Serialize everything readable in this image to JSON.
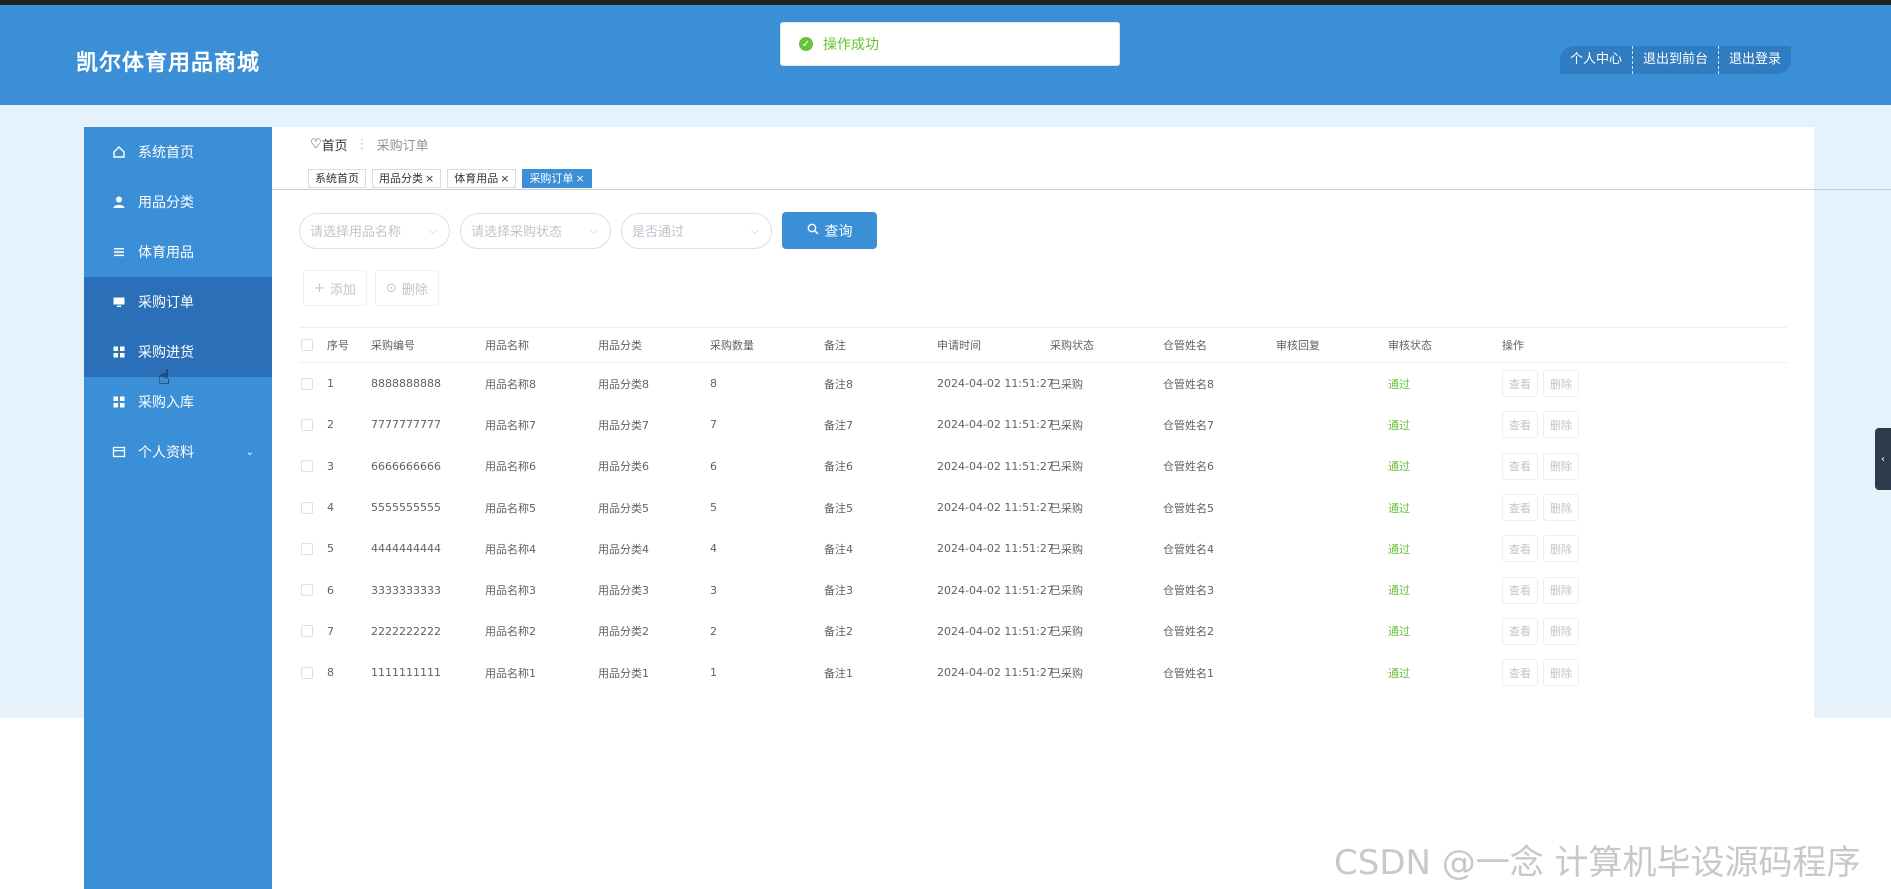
{
  "header": {
    "brand": "凯尔体育用品商城",
    "nav": [
      "个人中心",
      "退出到前台",
      "退出登录"
    ]
  },
  "toast": {
    "icon": "check-circle-icon",
    "text": "操作成功"
  },
  "sidebar": {
    "items": [
      {
        "label": "系统首页",
        "icon": "home-icon"
      },
      {
        "label": "用品分类",
        "icon": "user-icon"
      },
      {
        "label": "体育用品",
        "icon": "list-icon"
      },
      {
        "label": "采购订单",
        "icon": "monitor-icon"
      },
      {
        "label": "采购进货",
        "icon": "grid-icon"
      },
      {
        "label": "采购入库",
        "icon": "grid-icon"
      },
      {
        "label": "个人资料",
        "icon": "card-icon"
      }
    ]
  },
  "breadcrumb": {
    "home": "首页",
    "current": "采购订单"
  },
  "tags": [
    "系统首页",
    "用品分类",
    "体育用品",
    "采购订单"
  ],
  "filters": {
    "name_placeholder": "请选择用品名称",
    "status_placeholder": "请选择采购状态",
    "pass_placeholder": "是否通过",
    "query_label": "查询"
  },
  "actions": {
    "add": "添加",
    "delete": "删除"
  },
  "table": {
    "headers": [
      "序号",
      "采购编号",
      "用品名称",
      "用品分类",
      "采购数量",
      "备注",
      "申请时间",
      "采购状态",
      "仓管姓名",
      "审核回复",
      "审核状态",
      "操作"
    ],
    "rows": [
      [
        "1",
        "8888888888",
        "用品名称8",
        "用品分类8",
        "8",
        "备注8",
        "2024-04-02 11:51:27",
        "已采购",
        "仓管姓名8",
        "",
        "通过"
      ],
      [
        "2",
        "7777777777",
        "用品名称7",
        "用品分类7",
        "7",
        "备注7",
        "2024-04-02 11:51:27",
        "已采购",
        "仓管姓名7",
        "",
        "通过"
      ],
      [
        "3",
        "6666666666",
        "用品名称6",
        "用品分类6",
        "6",
        "备注6",
        "2024-04-02 11:51:27",
        "已采购",
        "仓管姓名6",
        "",
        "通过"
      ],
      [
        "4",
        "5555555555",
        "用品名称5",
        "用品分类5",
        "5",
        "备注5",
        "2024-04-02 11:51:27",
        "已采购",
        "仓管姓名5",
        "",
        "通过"
      ],
      [
        "5",
        "4444444444",
        "用品名称4",
        "用品分类4",
        "4",
        "备注4",
        "2024-04-02 11:51:27",
        "已采购",
        "仓管姓名4",
        "",
        "通过"
      ],
      [
        "6",
        "3333333333",
        "用品名称3",
        "用品分类3",
        "3",
        "备注3",
        "2024-04-02 11:51:27",
        "已采购",
        "仓管姓名3",
        "",
        "通过"
      ],
      [
        "7",
        "2222222222",
        "用品名称2",
        "用品分类2",
        "2",
        "备注2",
        "2024-04-02 11:51:27",
        "已采购",
        "仓管姓名2",
        "",
        "通过"
      ],
      [
        "8",
        "1111111111",
        "用品名称1",
        "用品分类1",
        "1",
        "备注1",
        "2024-04-02 11:51:27",
        "已采购",
        "仓管姓名1",
        "",
        "通过"
      ]
    ],
    "view_label": "查看",
    "delete_label": "删除"
  },
  "watermark": "CSDN @一念 计算机毕设源码程序",
  "colors": {
    "primary": "#3a8fd6",
    "active_menu": "#2a6fb8",
    "success": "#67c23a"
  }
}
